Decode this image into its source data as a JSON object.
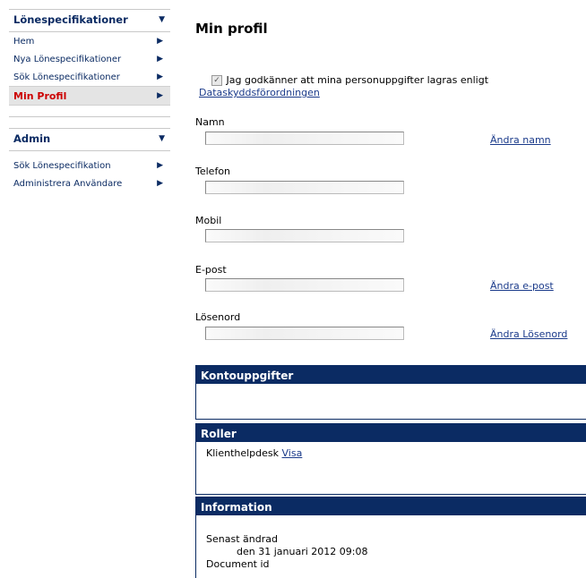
{
  "sidebar": {
    "section1": {
      "title": "Lönespecifikationer",
      "items": [
        {
          "label": "Hem"
        },
        {
          "label": "Nya Lönespecifikationer"
        },
        {
          "label": "Sök Lönespecifikationer"
        },
        {
          "label": "Min Profil"
        }
      ]
    },
    "section2": {
      "title": "Admin",
      "items": [
        {
          "label": "Sök Lönespecifikation"
        },
        {
          "label": "Administrera Användare"
        }
      ]
    }
  },
  "main": {
    "title": "Min profil",
    "consent": {
      "text": "Jag godkänner att mina personuppgifter lagras enligt",
      "link": "Dataskyddsförordningen",
      "checked": true
    },
    "fields": {
      "namn": {
        "label": "Namn",
        "value": "",
        "link": "Ändra namn"
      },
      "telefon": {
        "label": "Telefon",
        "value": ""
      },
      "mobil": {
        "label": "Mobil",
        "value": ""
      },
      "epost": {
        "label": "E-post",
        "value": "",
        "link": "Ändra e-post"
      },
      "losenord": {
        "label": "Lösenord",
        "value": "",
        "link": "Ändra Lösenord"
      }
    },
    "panels": {
      "konto": {
        "title": "Kontouppgifter"
      },
      "roller": {
        "title": "Roller",
        "role": "Klienthelpdesk",
        "link": "Visa"
      },
      "info": {
        "title": "Information",
        "changed_label": "Senast ändrad",
        "changed_value": "den 31 januari 2012 09:08",
        "docid_label": "Document id"
      }
    }
  },
  "colors": {
    "navy": "#0b2b63",
    "active_red": "#cc0000",
    "link": "#1a3a8a"
  }
}
